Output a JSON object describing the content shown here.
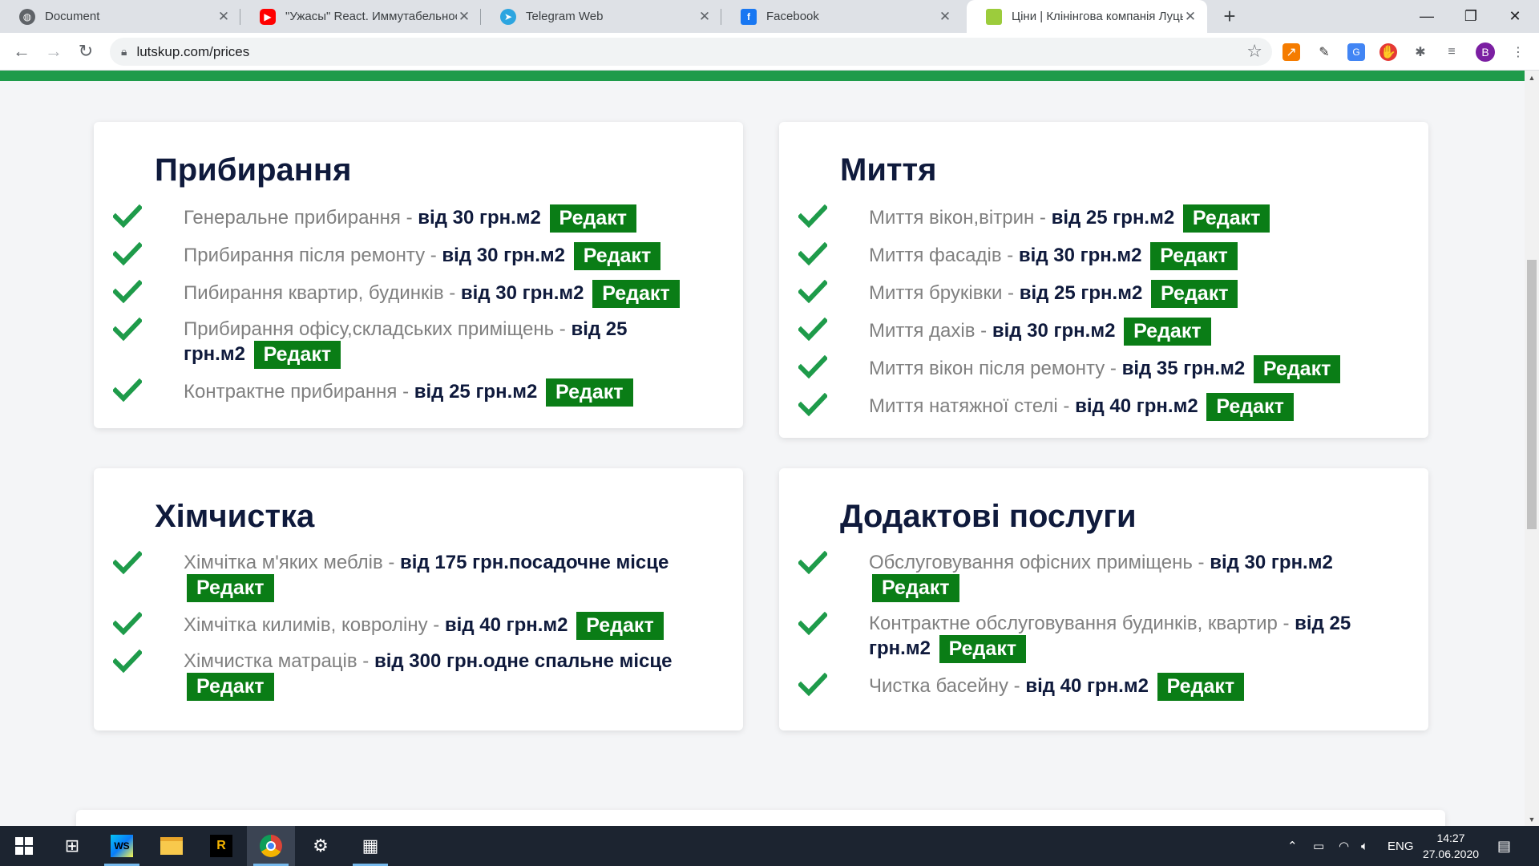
{
  "browser": {
    "tabs": [
      {
        "title": "Document",
        "favicon": "globe-icon",
        "color": "#5f6368"
      },
      {
        "title": "\"Ужасы\" React. Иммутабельност",
        "favicon": "youtube-icon",
        "color": "#ff0000"
      },
      {
        "title": "Telegram Web",
        "favicon": "telegram-icon",
        "color": "#2ca5e0"
      },
      {
        "title": "Facebook",
        "favicon": "facebook-icon",
        "color": "#1877f2"
      },
      {
        "title": "Ціни | Клінінгова компанія Луцьк",
        "favicon": "site-logo-icon",
        "color": "#9ccc3c"
      }
    ],
    "url": "lutskup.com/prices",
    "profile_initial": "B"
  },
  "accent_color": "#1e9b4a",
  "edit_button_color": "#0a7d16",
  "sections": [
    {
      "title": "Прибирання",
      "items": [
        {
          "name": "Генеральне прибирання",
          "price": "від 30 грн.м2",
          "edit": "Редакт"
        },
        {
          "name": "Прибирання після ремонту",
          "price": "від 30 грн.м2",
          "edit": "Редакт"
        },
        {
          "name": "Пибирання квартир, будинків",
          "price": "від 30 грн.м2",
          "edit": "Редакт"
        },
        {
          "name": "Прибирання офісу,складських приміщень",
          "price": "від 25 грн.м2",
          "edit": "Редакт"
        },
        {
          "name": "Контрактне прибирання",
          "price": "від 25 грн.м2",
          "edit": "Редакт"
        }
      ]
    },
    {
      "title": "Миття",
      "items": [
        {
          "name": "Миття вікон,вітрин",
          "price": "від 25 грн.м2",
          "edit": "Редакт"
        },
        {
          "name": "Миття фасадів",
          "price": "від 30 грн.м2",
          "edit": "Редакт"
        },
        {
          "name": "Миття бруківки",
          "price": "від 25 грн.м2",
          "edit": "Редакт"
        },
        {
          "name": "Миття дахів",
          "price": "від 30 грн.м2",
          "edit": "Редакт"
        },
        {
          "name": "Миття вікон після ремонту",
          "price": "від 35 грн.м2",
          "edit": "Редакт"
        },
        {
          "name": "Миття натяжної стелі",
          "price": "від 40 грн.м2",
          "edit": "Редакт"
        }
      ]
    },
    {
      "title": "Хімчистка",
      "items": [
        {
          "name": "Хімчітка м'яких меблів",
          "price": "від 175 грн.посадочне місце",
          "edit": "Редакт"
        },
        {
          "name": "Хімчітка килимів, ковроліну",
          "price": "від 40 грн.м2",
          "edit": "Редакт"
        },
        {
          "name": "Хімчистка матраців",
          "price": "від 300 грн.одне спальне місце",
          "edit": "Редакт"
        }
      ]
    },
    {
      "title": "Додактові послуги",
      "items": [
        {
          "name": "Обслуговування офісних приміщень",
          "price": "від 30 грн.м2",
          "edit": "Редакт"
        },
        {
          "name": "Контрактне обслуговування будинків, квартир",
          "price": "від 25 грн.м2",
          "edit": "Редакт"
        },
        {
          "name": "Чистка басейну",
          "price": "від 40 грн.м2",
          "edit": "Редакт"
        }
      ]
    }
  ],
  "taskbar": {
    "language": "ENG",
    "time": "14:27",
    "date": "27.06.2020"
  }
}
